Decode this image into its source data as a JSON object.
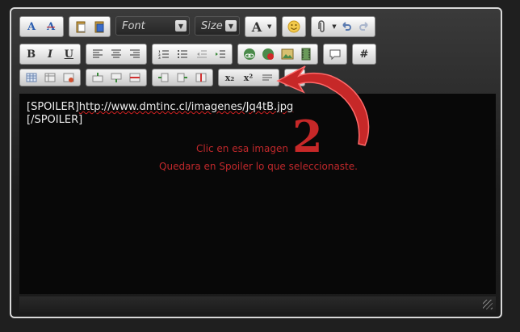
{
  "toolbar": {
    "row1": {
      "font_buttons": [
        {
          "label": "A",
          "icon": "font-size-icon"
        },
        {
          "label": "A",
          "icon": "remove-format-icon"
        }
      ],
      "paste_buttons": [
        {
          "icon": "paste-icon"
        },
        {
          "icon": "paste-word-icon"
        }
      ],
      "font_select": {
        "value": "Font"
      },
      "size_select": {
        "value": "Size"
      },
      "color_button": {
        "label": "A",
        "icon": "font-color-icon"
      },
      "smiley_icon": "smiley-icon",
      "attach_icon": "attachment-icon",
      "undo_icon": "undo-icon",
      "redo_icon": "redo-icon"
    },
    "row2": {
      "bold": "B",
      "italic": "I",
      "underline": "U",
      "hash": "#"
    },
    "row3": {
      "subscript": "x₂",
      "superscript": "x²"
    }
  },
  "editor": {
    "lines": [
      {
        "prefix": "[SPOILER]",
        "text": "http://www.dmtinc.cl/imagenes/Jq4tB.jpg"
      },
      {
        "prefix": "[/SPOILER]",
        "text": ""
      }
    ]
  },
  "annotation": {
    "number": "2",
    "line1": "Clic en esa imagen",
    "line2": "Quedara en Spoiler lo que seleccionaste."
  },
  "colors": {
    "annotation_red": "#c0282b",
    "editor_bg": "#080808",
    "text": "#ededed"
  }
}
